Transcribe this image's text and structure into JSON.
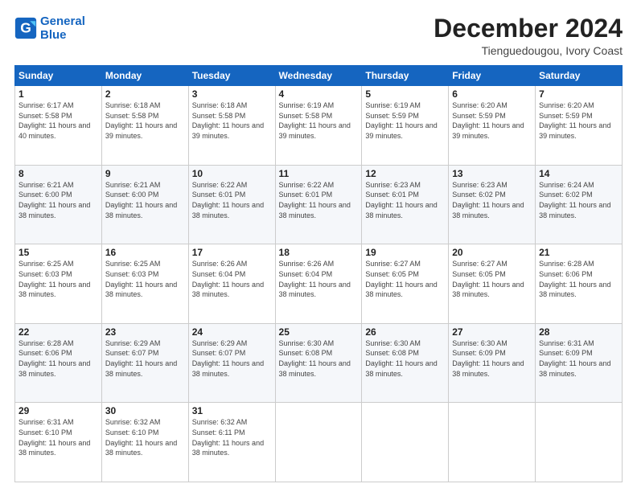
{
  "logo": {
    "line1": "General",
    "line2": "Blue"
  },
  "title": "December 2024",
  "subtitle": "Tienguedougou, Ivory Coast",
  "days_of_week": [
    "Sunday",
    "Monday",
    "Tuesday",
    "Wednesday",
    "Thursday",
    "Friday",
    "Saturday"
  ],
  "weeks": [
    [
      {
        "day": "1",
        "sunrise": "6:17 AM",
        "sunset": "5:58 PM",
        "daylight": "11 hours and 40 minutes."
      },
      {
        "day": "2",
        "sunrise": "6:18 AM",
        "sunset": "5:58 PM",
        "daylight": "11 hours and 39 minutes."
      },
      {
        "day": "3",
        "sunrise": "6:18 AM",
        "sunset": "5:58 PM",
        "daylight": "11 hours and 39 minutes."
      },
      {
        "day": "4",
        "sunrise": "6:19 AM",
        "sunset": "5:58 PM",
        "daylight": "11 hours and 39 minutes."
      },
      {
        "day": "5",
        "sunrise": "6:19 AM",
        "sunset": "5:59 PM",
        "daylight": "11 hours and 39 minutes."
      },
      {
        "day": "6",
        "sunrise": "6:20 AM",
        "sunset": "5:59 PM",
        "daylight": "11 hours and 39 minutes."
      },
      {
        "day": "7",
        "sunrise": "6:20 AM",
        "sunset": "5:59 PM",
        "daylight": "11 hours and 39 minutes."
      }
    ],
    [
      {
        "day": "8",
        "sunrise": "6:21 AM",
        "sunset": "6:00 PM",
        "daylight": "11 hours and 38 minutes."
      },
      {
        "day": "9",
        "sunrise": "6:21 AM",
        "sunset": "6:00 PM",
        "daylight": "11 hours and 38 minutes."
      },
      {
        "day": "10",
        "sunrise": "6:22 AM",
        "sunset": "6:01 PM",
        "daylight": "11 hours and 38 minutes."
      },
      {
        "day": "11",
        "sunrise": "6:22 AM",
        "sunset": "6:01 PM",
        "daylight": "11 hours and 38 minutes."
      },
      {
        "day": "12",
        "sunrise": "6:23 AM",
        "sunset": "6:01 PM",
        "daylight": "11 hours and 38 minutes."
      },
      {
        "day": "13",
        "sunrise": "6:23 AM",
        "sunset": "6:02 PM",
        "daylight": "11 hours and 38 minutes."
      },
      {
        "day": "14",
        "sunrise": "6:24 AM",
        "sunset": "6:02 PM",
        "daylight": "11 hours and 38 minutes."
      }
    ],
    [
      {
        "day": "15",
        "sunrise": "6:25 AM",
        "sunset": "6:03 PM",
        "daylight": "11 hours and 38 minutes."
      },
      {
        "day": "16",
        "sunrise": "6:25 AM",
        "sunset": "6:03 PM",
        "daylight": "11 hours and 38 minutes."
      },
      {
        "day": "17",
        "sunrise": "6:26 AM",
        "sunset": "6:04 PM",
        "daylight": "11 hours and 38 minutes."
      },
      {
        "day": "18",
        "sunrise": "6:26 AM",
        "sunset": "6:04 PM",
        "daylight": "11 hours and 38 minutes."
      },
      {
        "day": "19",
        "sunrise": "6:27 AM",
        "sunset": "6:05 PM",
        "daylight": "11 hours and 38 minutes."
      },
      {
        "day": "20",
        "sunrise": "6:27 AM",
        "sunset": "6:05 PM",
        "daylight": "11 hours and 38 minutes."
      },
      {
        "day": "21",
        "sunrise": "6:28 AM",
        "sunset": "6:06 PM",
        "daylight": "11 hours and 38 minutes."
      }
    ],
    [
      {
        "day": "22",
        "sunrise": "6:28 AM",
        "sunset": "6:06 PM",
        "daylight": "11 hours and 38 minutes."
      },
      {
        "day": "23",
        "sunrise": "6:29 AM",
        "sunset": "6:07 PM",
        "daylight": "11 hours and 38 minutes."
      },
      {
        "day": "24",
        "sunrise": "6:29 AM",
        "sunset": "6:07 PM",
        "daylight": "11 hours and 38 minutes."
      },
      {
        "day": "25",
        "sunrise": "6:30 AM",
        "sunset": "6:08 PM",
        "daylight": "11 hours and 38 minutes."
      },
      {
        "day": "26",
        "sunrise": "6:30 AM",
        "sunset": "6:08 PM",
        "daylight": "11 hours and 38 minutes."
      },
      {
        "day": "27",
        "sunrise": "6:30 AM",
        "sunset": "6:09 PM",
        "daylight": "11 hours and 38 minutes."
      },
      {
        "day": "28",
        "sunrise": "6:31 AM",
        "sunset": "6:09 PM",
        "daylight": "11 hours and 38 minutes."
      }
    ],
    [
      {
        "day": "29",
        "sunrise": "6:31 AM",
        "sunset": "6:10 PM",
        "daylight": "11 hours and 38 minutes."
      },
      {
        "day": "30",
        "sunrise": "6:32 AM",
        "sunset": "6:10 PM",
        "daylight": "11 hours and 38 minutes."
      },
      {
        "day": "31",
        "sunrise": "6:32 AM",
        "sunset": "6:11 PM",
        "daylight": "11 hours and 38 minutes."
      },
      null,
      null,
      null,
      null
    ]
  ]
}
